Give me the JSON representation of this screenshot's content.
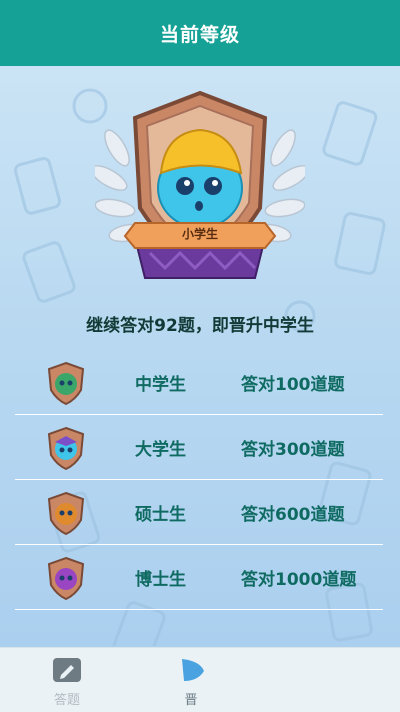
{
  "header": {
    "title": "当前等级"
  },
  "current_level": {
    "badge_label": "小学生"
  },
  "hint": "继续答对92题，即晋升中学生",
  "levels": [
    {
      "name": "中学生",
      "requirement": "答对100道题",
      "badge_color": "#3aa66a"
    },
    {
      "name": "大学生",
      "requirement": "答对300道题",
      "badge_color": "#7a4fc8"
    },
    {
      "name": "硕士生",
      "requirement": "答对600道题",
      "badge_color": "#e08a2e"
    },
    {
      "name": "博士生",
      "requirement": "答对1000道题",
      "badge_color": "#9a45c2"
    }
  ],
  "tabbar": {
    "tabs": [
      {
        "label": "答题",
        "icon": "pencil-square-icon"
      },
      {
        "label": "晋",
        "icon": "rank-badge-icon"
      }
    ]
  },
  "colors": {
    "header": "#15a195",
    "text": "#0f6b62"
  }
}
